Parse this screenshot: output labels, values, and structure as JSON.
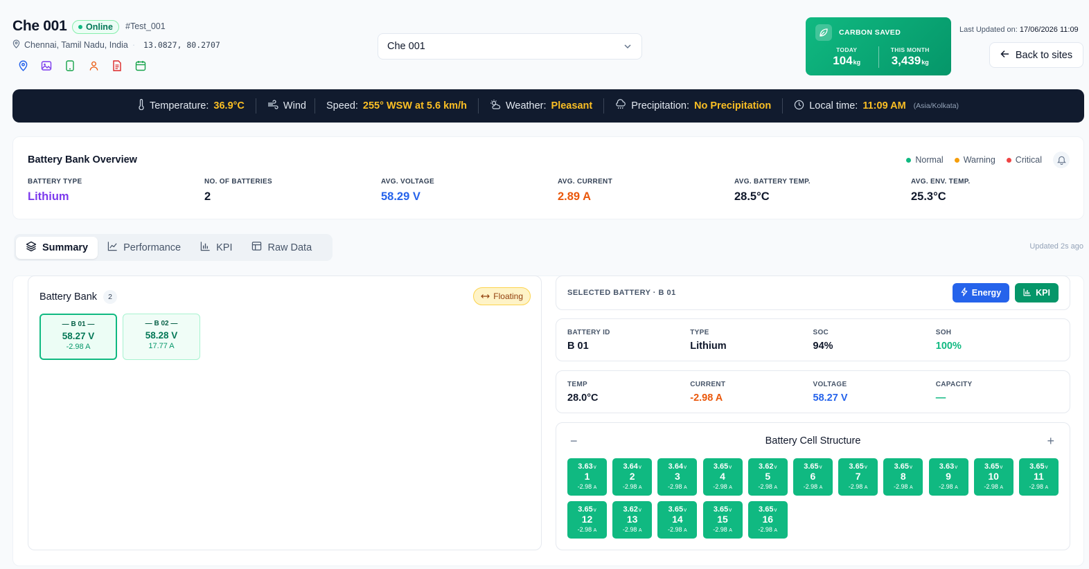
{
  "site": {
    "name": "Che 001",
    "status": "Online",
    "tag": "#Test_001",
    "location": "Chennai, Tamil Nadu, India",
    "coordinates": "13.0827, 80.2707",
    "quick_icons": [
      "map-pin-icon",
      "image-icon",
      "tablet-icon",
      "user-icon",
      "document-icon",
      "calendar-icon"
    ]
  },
  "site_selector": {
    "value": "Che 001"
  },
  "carbon": {
    "title": "CARBON SAVED",
    "today_label": "TODAY",
    "today_value": "104",
    "today_unit": "kg",
    "month_label": "THIS MONTH",
    "month_value": "3,439",
    "month_unit": "kg"
  },
  "last_updated": {
    "label": "Last Updated on:",
    "value": "17/06/2026 11:09"
  },
  "back_button": {
    "label": "Back to sites"
  },
  "weather": {
    "temperature_label": "Temperature:",
    "temperature_value": "36.9°C",
    "wind_label": "Wind",
    "speed_label": "Speed:",
    "speed_value": "255° WSW at 5.6 km/h",
    "weather_label": "Weather:",
    "weather_value": "Pleasant",
    "precip_label": "Precipitation:",
    "precip_value": "No Precipitation",
    "time_label": "Local time:",
    "time_value": "11:09 AM",
    "timezone": "(Asia/Kolkata)"
  },
  "overview": {
    "title": "Battery Bank Overview",
    "legend": [
      {
        "label": "Normal",
        "color": "#10b981"
      },
      {
        "label": "Warning",
        "color": "#f59e0b"
      },
      {
        "label": "Critical",
        "color": "#ef4444"
      }
    ],
    "stats": [
      {
        "label": "BATTERY TYPE",
        "value": "Lithium",
        "color": "#7c3aed"
      },
      {
        "label": "NO. OF BATTERIES",
        "value": "2",
        "color": "#0f172a"
      },
      {
        "label": "AVG. VOLTAGE",
        "value": "58.29 V",
        "color": "#2563eb"
      },
      {
        "label": "AVG. CURRENT",
        "value": "2.89 A",
        "color": "#ea580c"
      },
      {
        "label": "AVG. BATTERY TEMP.",
        "value": "28.5°C",
        "color": "#0f172a"
      },
      {
        "label": "AVG. ENV. TEMP.",
        "value": "25.3°C",
        "color": "#0f172a"
      }
    ]
  },
  "tabs": [
    {
      "label": "Summary",
      "icon": "layers-icon",
      "active": true
    },
    {
      "label": "Performance",
      "icon": "line-chart-icon",
      "active": false
    },
    {
      "label": "KPI",
      "icon": "bar-chart-icon",
      "active": false
    },
    {
      "label": "Raw Data",
      "icon": "table-icon",
      "active": false
    }
  ],
  "updated_ago": "Updated 2s ago",
  "bank": {
    "title": "Battery Bank",
    "count": "2",
    "mode": "Floating",
    "batteries": [
      {
        "id": "B 01",
        "voltage": "58.27 V",
        "current": "-2.98 A",
        "selected": true
      },
      {
        "id": "B 02",
        "voltage": "58.28 V",
        "current": "17.77 A",
        "selected": false
      }
    ]
  },
  "selected": {
    "label": "SELECTED BATTERY · B 01",
    "energy_button": "Energy",
    "kpi_button": "KPI",
    "row1": [
      {
        "label": "BATTERY ID",
        "value": "B 01",
        "color": "#0f172a"
      },
      {
        "label": "TYPE",
        "value": "Lithium",
        "color": "#0f172a"
      },
      {
        "label": "SOC",
        "value": "94%",
        "color": "#0f172a"
      },
      {
        "label": "SOH",
        "value": "100%",
        "color": "#10b981"
      }
    ],
    "row2": [
      {
        "label": "TEMP",
        "value": "28.0°C",
        "color": "#0f172a"
      },
      {
        "label": "CURRENT",
        "value": "-2.98 A",
        "color": "#ea580c"
      },
      {
        "label": "VOLTAGE",
        "value": "58.27 V",
        "color": "#2563eb"
      },
      {
        "label": "CAPACITY",
        "value": "—",
        "color": "#10b981"
      }
    ]
  },
  "cells": {
    "title": "Battery Cell Structure",
    "voltage_unit": "v",
    "current_unit": "A",
    "items": [
      {
        "n": "1",
        "v": "3.63",
        "a": "-2.98"
      },
      {
        "n": "2",
        "v": "3.64",
        "a": "-2.98"
      },
      {
        "n": "3",
        "v": "3.64",
        "a": "-2.98"
      },
      {
        "n": "4",
        "v": "3.65",
        "a": "-2.98"
      },
      {
        "n": "5",
        "v": "3.62",
        "a": "-2.98"
      },
      {
        "n": "6",
        "v": "3.65",
        "a": "-2.98"
      },
      {
        "n": "7",
        "v": "3.65",
        "a": "-2.98"
      },
      {
        "n": "8",
        "v": "3.65",
        "a": "-2.98"
      },
      {
        "n": "9",
        "v": "3.63",
        "a": "-2.98"
      },
      {
        "n": "10",
        "v": "3.65",
        "a": "-2.98"
      },
      {
        "n": "11",
        "v": "3.65",
        "a": "-2.98"
      },
      {
        "n": "12",
        "v": "3.65",
        "a": "-2.98"
      },
      {
        "n": "13",
        "v": "3.62",
        "a": "-2.98"
      },
      {
        "n": "14",
        "v": "3.65",
        "a": "-2.98"
      },
      {
        "n": "15",
        "v": "3.65",
        "a": "-2.98"
      },
      {
        "n": "16",
        "v": "3.65",
        "a": "-2.98"
      }
    ]
  }
}
